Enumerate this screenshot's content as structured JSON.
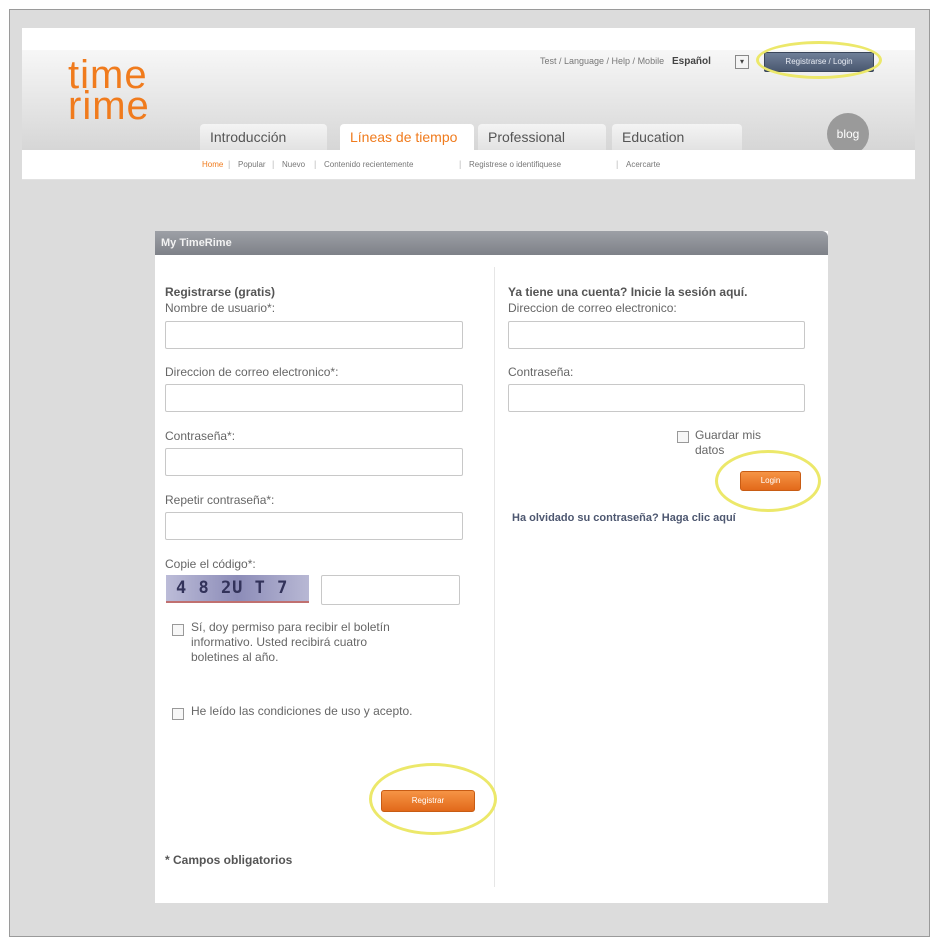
{
  "header": {
    "logo_line1": "time",
    "logo_line2": "rime",
    "top_links": "Test / Language / Help / Mobile",
    "language": "Español",
    "language_dropdown": "▾",
    "login_button": "Registrarse / Login",
    "tabs": [
      {
        "label": "Introducción",
        "active": false
      },
      {
        "label": "Líneas de tiempo",
        "active": true
      },
      {
        "label": "Professional",
        "active": false
      },
      {
        "label": "Education",
        "active": false
      }
    ],
    "blog_label": "blog",
    "subnav": [
      {
        "label": "Home",
        "active": true
      },
      {
        "label": "Popular",
        "active": false
      },
      {
        "label": "Nuevo",
        "active": false
      },
      {
        "label": "Contenido recientemente",
        "active": false
      },
      {
        "label": "Registrese o identifiquese",
        "active": false
      },
      {
        "label": "Acercarte",
        "active": false
      }
    ]
  },
  "panel": {
    "title": "My TimeRime",
    "register": {
      "heading": "Registrarse (gratis)",
      "username_label": "Nombre de usuario*:",
      "email_label": "Direccion de correo electronico*:",
      "password_label": "Contraseña*:",
      "repeat_password_label": "Repetir contraseña*:",
      "captcha_label": "Copie el código*:",
      "captcha_text": "4 8 2U T 7",
      "newsletter_text": "Sí, doy permiso para recibir el boletín informativo. Usted recibirá cuatro boletines al año.",
      "terms_text": "He leído las condiciones de uso y acepto.",
      "submit_label": "Registrar",
      "required_note": "* Campos obligatorios"
    },
    "login": {
      "heading": "Ya tiene una cuenta? Inicie la sesión aquí.",
      "email_label": "Direccion de correo electronico:",
      "password_label": "Contraseña:",
      "remember_label": "Guardar mis datos",
      "submit_label": "Login",
      "forgot_text": "Ha olvidado su contraseña? Haga clic aquí"
    }
  },
  "colors": {
    "accent": "#f07b1d",
    "highlight": "#ece86a",
    "panel_header": "#8a8d93",
    "page_bg": "#dcdcdc"
  }
}
